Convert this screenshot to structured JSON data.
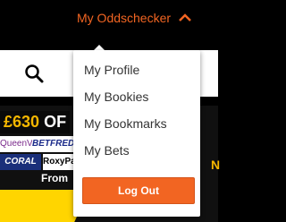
{
  "header": {
    "account_label": "My Oddschecker",
    "account_caret_icon": "chevron-up-icon",
    "accent_color": "#f26522"
  },
  "search": {
    "icon": "search-icon"
  },
  "promo": {
    "amount": "£630",
    "headline_rest": "OF",
    "logos": [
      "QueenVegas",
      "BETFRED",
      "CORAL",
      "RoxyPalace"
    ],
    "from_text": "From",
    "edge_char": "N"
  },
  "dropdown": {
    "items": [
      {
        "label": "My Profile"
      },
      {
        "label": "My Bookies"
      },
      {
        "label": "My Bookmarks"
      },
      {
        "label": "My Bets"
      }
    ],
    "logout_label": "Log Out"
  }
}
